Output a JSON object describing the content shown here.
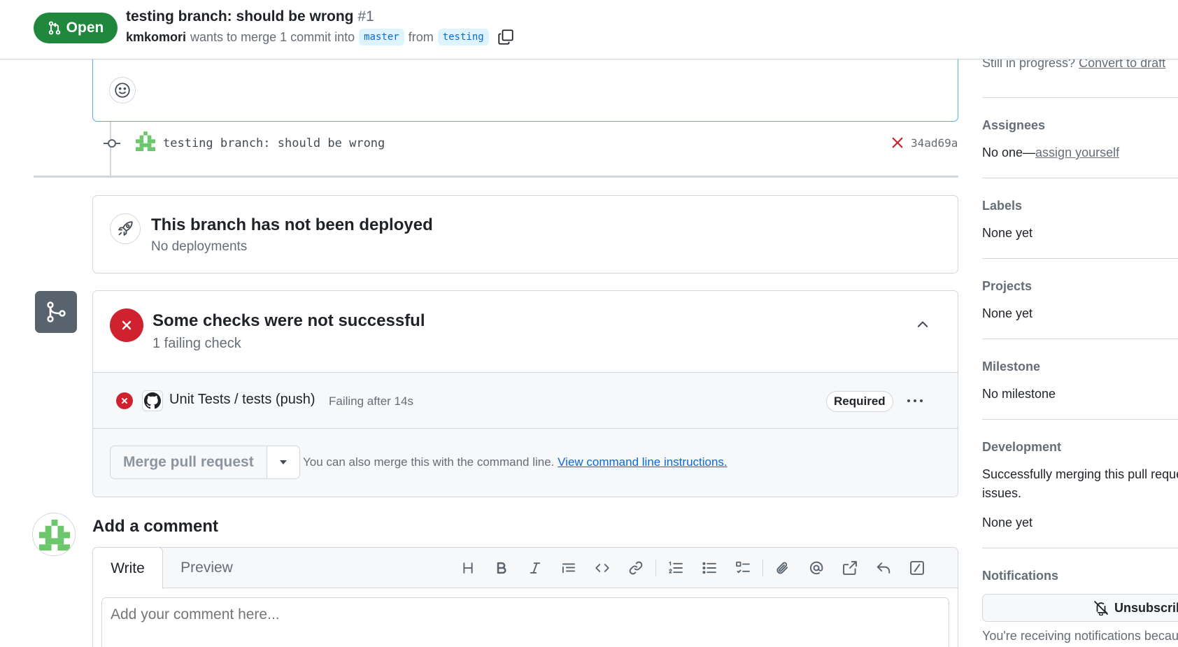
{
  "header": {
    "state": "Open",
    "title": "testing branch: should be wrong",
    "number": "#1",
    "author": "kmkomori",
    "merge_text": "wants to merge 1 commit into",
    "base_branch": "master",
    "from_text": "from",
    "head_branch": "testing"
  },
  "commit": {
    "message": "testing branch: should be wrong",
    "sha": "34ad69a"
  },
  "deployment": {
    "title": "This branch has not been deployed",
    "subtitle": "No deployments"
  },
  "checks": {
    "title": "Some checks were not successful",
    "subtitle": "1 failing check",
    "items": [
      {
        "name": "Unit Tests / tests (push)",
        "status": "Failing after 14s",
        "badge": "Required"
      }
    ]
  },
  "merge": {
    "button_label": "Merge pull request",
    "note": "You can also merge this with the command line.",
    "link": "View command line instructions."
  },
  "comment": {
    "heading": "Add a comment",
    "tab_write": "Write",
    "tab_preview": "Preview",
    "placeholder": "Add your comment here..."
  },
  "sidebar": {
    "draft_prefix": "Still in progress?",
    "draft_link": "Convert to draft",
    "assignees_heading": "Assignees",
    "assignees_prefix": "No one—",
    "assignees_link": "assign yourself",
    "labels_heading": "Labels",
    "labels_value": "None yet",
    "projects_heading": "Projects",
    "projects_value": "None yet",
    "milestone_heading": "Milestone",
    "milestone_value": "No milestone",
    "development_heading": "Development",
    "development_text_1": "Successfully merging this pull reque",
    "development_text_2": "issues.",
    "development_value": "None yet",
    "notifications_heading": "Notifications",
    "unsubscribe_label": "Unsubscribe",
    "notifications_note": "You're receiving notifications becau"
  },
  "colors": {
    "open_green": "#1f883d",
    "danger_red": "#cf222e",
    "link_blue": "#0969da",
    "border": "#d0d7de",
    "avatar_green": "#6cc76c"
  }
}
